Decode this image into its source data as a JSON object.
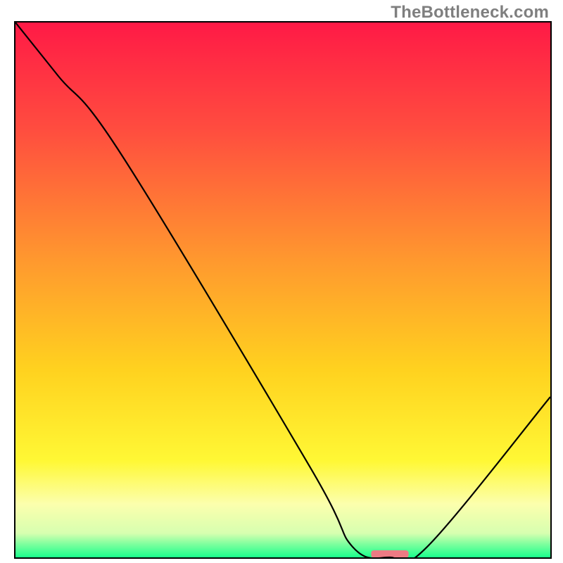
{
  "watermark": "TheBottleneck.com",
  "chart_data": {
    "type": "line",
    "title": "",
    "xlabel": "",
    "ylabel": "",
    "xlim": [
      0,
      100
    ],
    "ylim": [
      0,
      100
    ],
    "grid": false,
    "legend": false,
    "series": [
      {
        "name": "bottleneck-curve",
        "x": [
          0,
          8,
          20,
          55,
          63,
          70,
          77,
          100
        ],
        "y": [
          100,
          90,
          75,
          17,
          2,
          0,
          2,
          30
        ]
      }
    ],
    "marker": {
      "name": "optimum-bar",
      "x_center": 70,
      "width": 7,
      "y": 0.6,
      "color": "#ed7b84"
    },
    "background_gradient": [
      {
        "offset": 0.0,
        "color": "#ff1a46"
      },
      {
        "offset": 0.2,
        "color": "#ff4d3f"
      },
      {
        "offset": 0.45,
        "color": "#ff9a2e"
      },
      {
        "offset": 0.65,
        "color": "#ffd21f"
      },
      {
        "offset": 0.82,
        "color": "#fff835"
      },
      {
        "offset": 0.9,
        "color": "#fcffad"
      },
      {
        "offset": 0.955,
        "color": "#d7ffb0"
      },
      {
        "offset": 0.975,
        "color": "#7fff9e"
      },
      {
        "offset": 1.0,
        "color": "#1aff8c"
      }
    ]
  }
}
